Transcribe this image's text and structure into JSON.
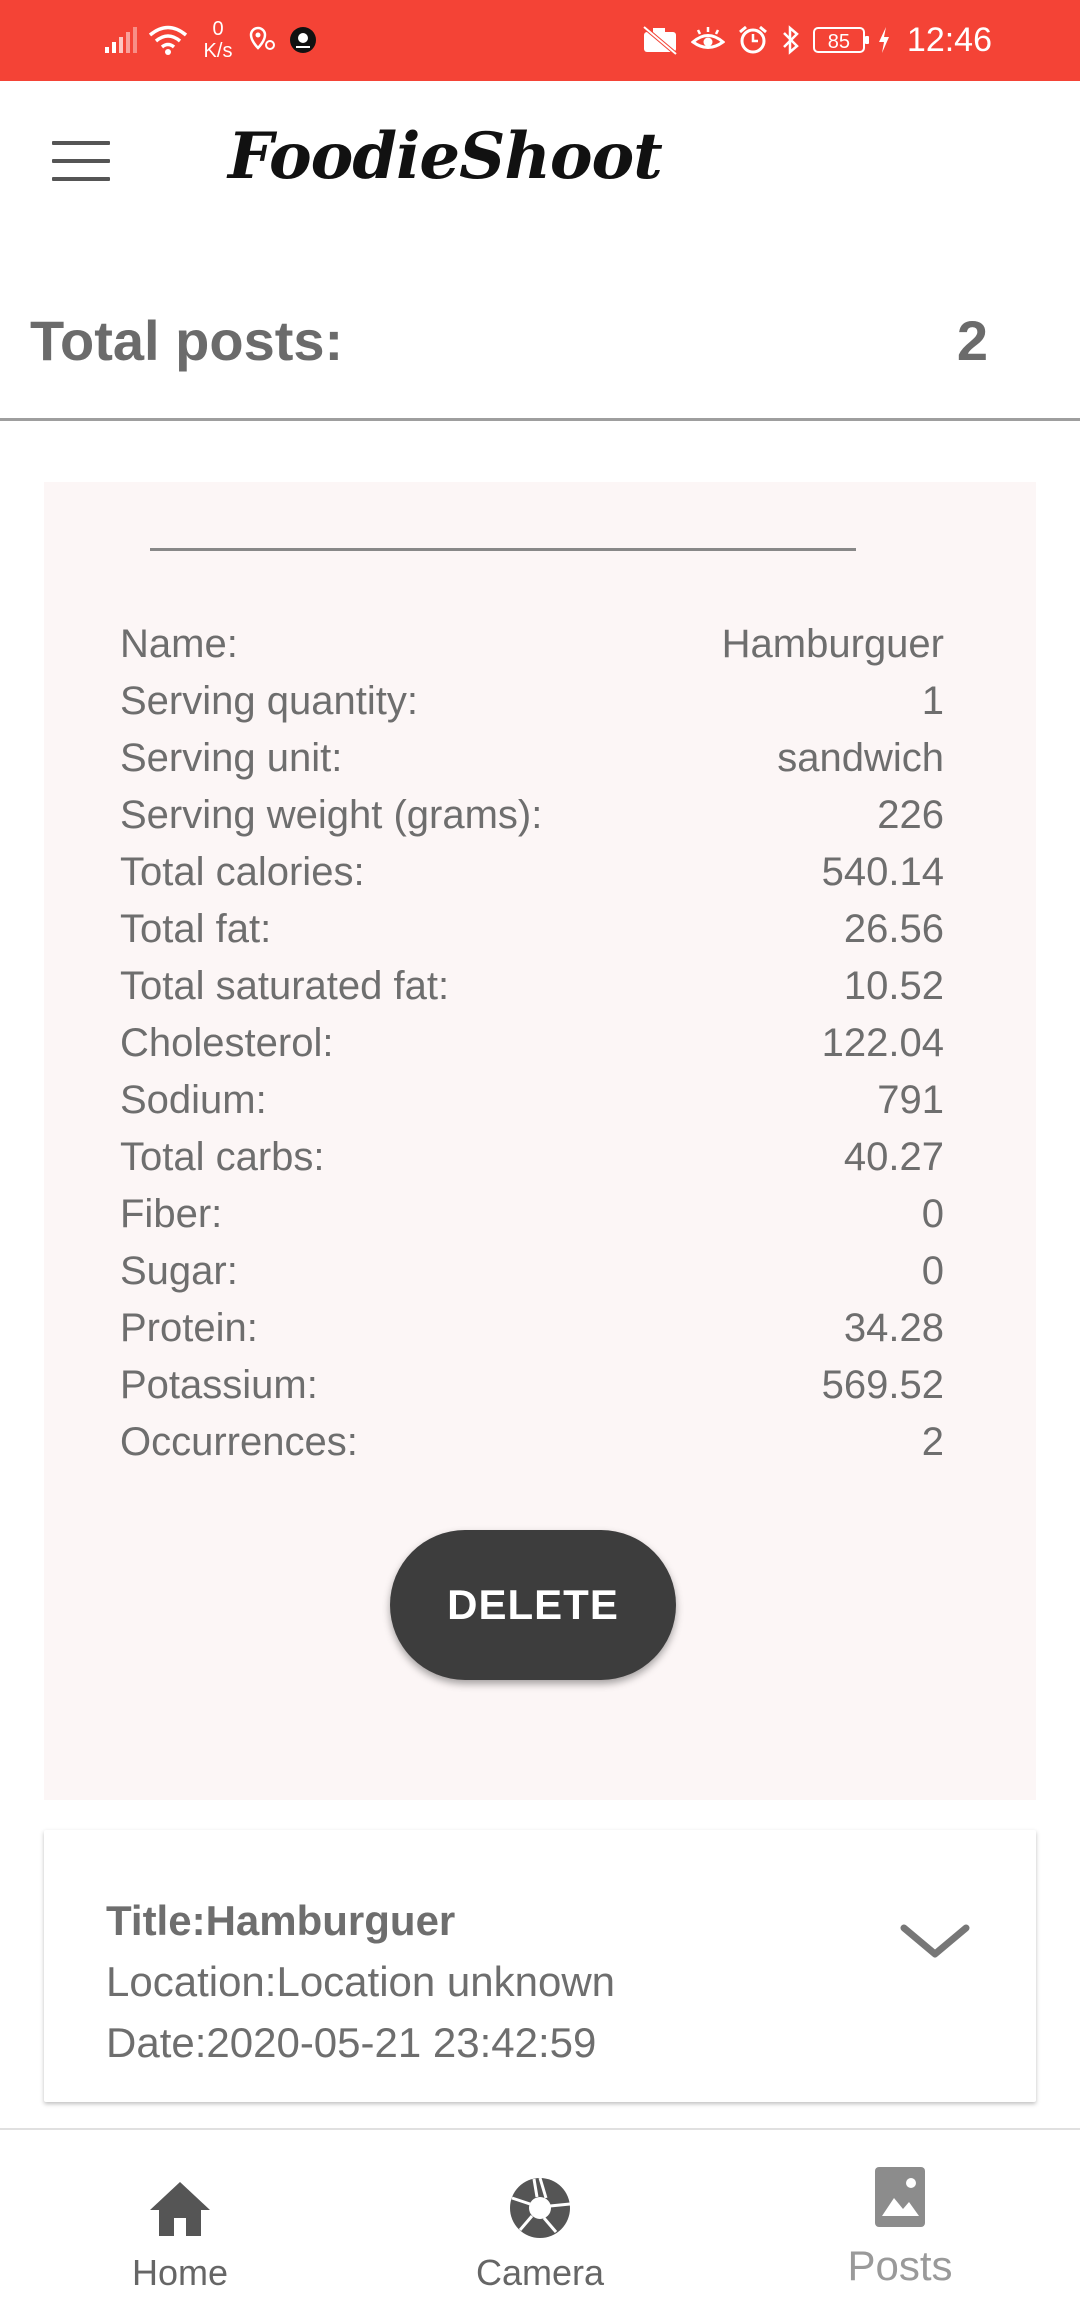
{
  "status_bar": {
    "net_speed_value": "0",
    "net_speed_unit": "K/s",
    "battery": "85",
    "time": "12:46",
    "background_color": "#f44336"
  },
  "app": {
    "title": "FoodieShoot",
    "menu_icon": "hamburger-menu-icon"
  },
  "summary": {
    "total_posts_label": "Total posts:",
    "total_posts_value": "2"
  },
  "detail": {
    "rows": [
      {
        "label": "Name:",
        "value": "Hamburguer"
      },
      {
        "label": "Serving quantity:",
        "value": "1"
      },
      {
        "label": "Serving unit:",
        "value": "sandwich"
      },
      {
        "label": "Serving weight (grams):",
        "value": "226"
      },
      {
        "label": "Total calories:",
        "value": "540.14"
      },
      {
        "label": "Total fat:",
        "value": "26.56"
      },
      {
        "label": "Total saturated fat:",
        "value": "10.52"
      },
      {
        "label": "Cholesterol:",
        "value": "122.04"
      },
      {
        "label": "Sodium:",
        "value": "791"
      },
      {
        "label": "Total carbs:",
        "value": "40.27"
      },
      {
        "label": "Fiber:",
        "value": "0"
      },
      {
        "label": "Sugar:",
        "value": "0"
      },
      {
        "label": "Protein:",
        "value": "34.28"
      },
      {
        "label": "Potassium:",
        "value": "569.52"
      },
      {
        "label": "Occurrences:",
        "value": "2"
      }
    ],
    "delete_label": "DELETE"
  },
  "post": {
    "title_line": "Title:Hamburguer",
    "location_line": "Location:Location unknown",
    "date_line": "Date:2020-05-21 23:42:59",
    "expand_icon": "chevron-down-icon"
  },
  "bottom_nav": {
    "items": [
      {
        "label": "Home",
        "icon": "home-icon"
      },
      {
        "label": "Camera",
        "icon": "camera-shutter-icon"
      },
      {
        "label": "Posts",
        "icon": "image-icon",
        "active": true
      }
    ]
  }
}
